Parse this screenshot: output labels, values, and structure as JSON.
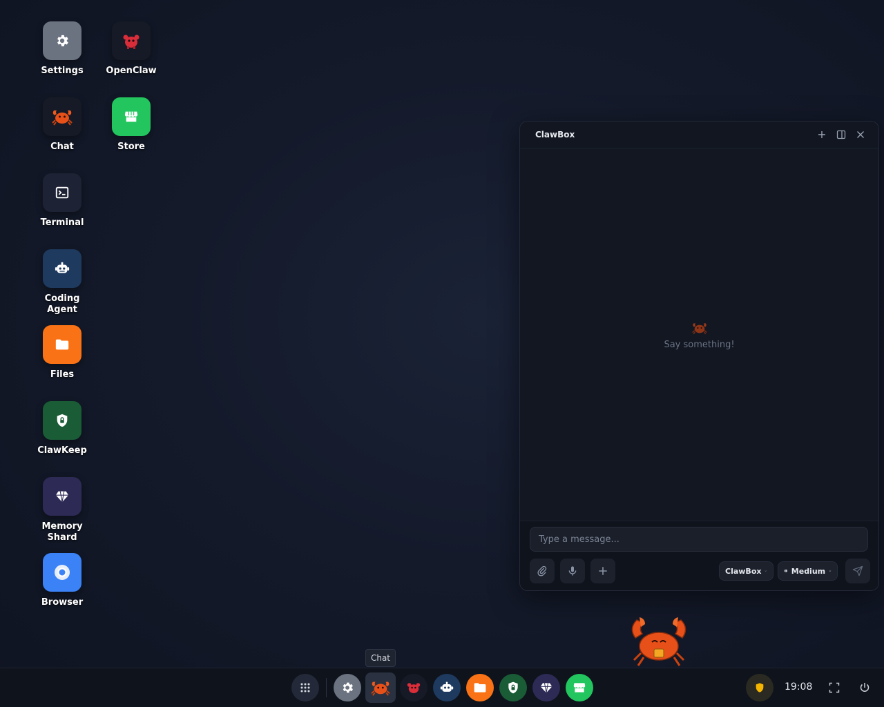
{
  "desktop": {
    "icons": [
      {
        "label": "Settings",
        "color": "#6b7280"
      },
      {
        "label": "OpenClaw",
        "color": "#151a26"
      },
      {
        "label": "Chat",
        "color": "#151a26"
      },
      {
        "label": "Store",
        "color": "#22c55e"
      },
      {
        "label": "Terminal",
        "color": "#1e2235"
      },
      {
        "label": "Coding Agent",
        "color": "#1e3a5f"
      },
      {
        "label": "Files",
        "color": "#f97316"
      },
      {
        "label": "ClawKeep",
        "color": "#1a5c36"
      },
      {
        "label": "Memory Shard",
        "color": "#2d2a55"
      },
      {
        "label": "Browser",
        "color": "#3b82f6"
      }
    ]
  },
  "chat_window": {
    "title": "ClawBox",
    "empty_state": "Say something!",
    "input_placeholder": "Type a message...",
    "model_label": "ClawBox",
    "effort_label": "Medium"
  },
  "tooltip": {
    "label": "Chat"
  },
  "taskbar": {
    "clock": "19:08",
    "apps": [
      "apps-grid",
      "settings",
      "chat",
      "openclaw",
      "coding-agent",
      "files",
      "clawkeep",
      "memory-shard",
      "store"
    ],
    "active_app": "chat"
  },
  "colors": {
    "accent_orange": "#f97316",
    "accent_green": "#22c55e",
    "shield_yellow": "#f5b400"
  }
}
